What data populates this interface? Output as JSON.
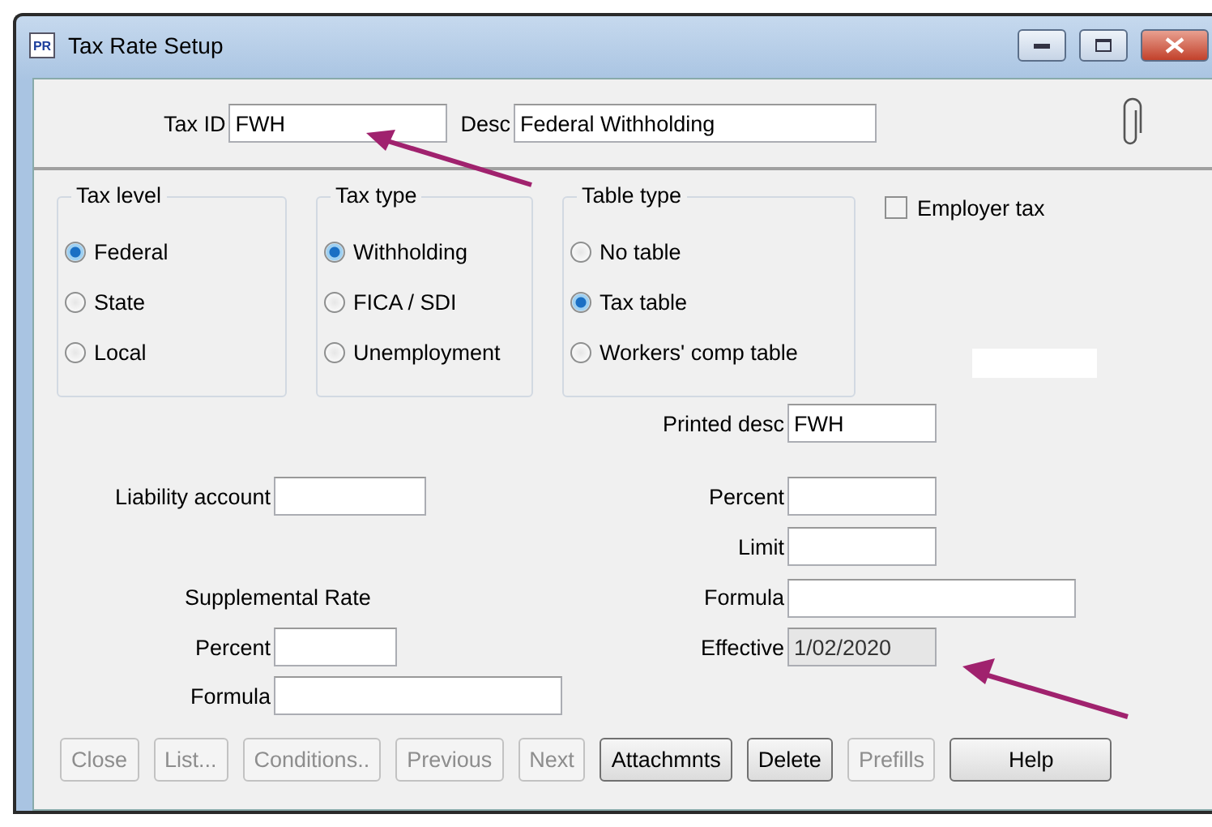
{
  "window": {
    "icon_text": "PR",
    "title": "Tax Rate Setup"
  },
  "header": {
    "tax_id": {
      "label": "Tax ID",
      "value": "FWH"
    },
    "desc": {
      "label": "Desc",
      "value": "Federal Withholding"
    }
  },
  "groups": [
    {
      "title": "Tax level",
      "options": [
        {
          "label": "Federal",
          "selected": true
        },
        {
          "label": "State",
          "selected": false
        },
        {
          "label": "Local",
          "selected": false
        }
      ]
    },
    {
      "title": "Tax type",
      "options": [
        {
          "label": "Withholding",
          "selected": true
        },
        {
          "label": "FICA / SDI",
          "selected": false
        },
        {
          "label": "Unemployment",
          "selected": false
        }
      ]
    },
    {
      "title": "Table type",
      "options": [
        {
          "label": "No table",
          "selected": false
        },
        {
          "label": "Tax table",
          "selected": true
        },
        {
          "label": "Workers' comp table",
          "selected": false
        }
      ]
    }
  ],
  "employer_tax": {
    "label": "Employer tax",
    "checked": false
  },
  "right_fields": [
    {
      "label": "Printed desc",
      "value": "FWH",
      "disabled": false
    },
    {
      "label": "Percent",
      "disabled": false
    },
    {
      "label": "Limit",
      "disabled": false
    },
    {
      "label": "Formula",
      "disabled": false
    },
    {
      "label": "Effective",
      "value": "1/02/2020",
      "disabled": true
    }
  ],
  "liability_account": {
    "label": "Liability account"
  },
  "supplemental": {
    "title": "Supplemental Rate",
    "fields": [
      {
        "label": "Percent"
      },
      {
        "label": "Formula"
      }
    ]
  },
  "buttons": [
    {
      "label": "Close",
      "disabled": true,
      "wide": false
    },
    {
      "label": "List...",
      "disabled": true,
      "wide": false
    },
    {
      "label": "Conditions..",
      "disabled": true,
      "wide": false
    },
    {
      "label": "Previous",
      "disabled": true,
      "wide": false
    },
    {
      "label": "Next",
      "disabled": true,
      "wide": false
    },
    {
      "label": "Attachmnts",
      "disabled": false,
      "wide": false
    },
    {
      "label": "Delete",
      "disabled": false,
      "wide": false
    },
    {
      "label": "Prefills",
      "disabled": true,
      "wide": false
    },
    {
      "label": "Help",
      "disabled": false,
      "wide": true
    }
  ]
}
